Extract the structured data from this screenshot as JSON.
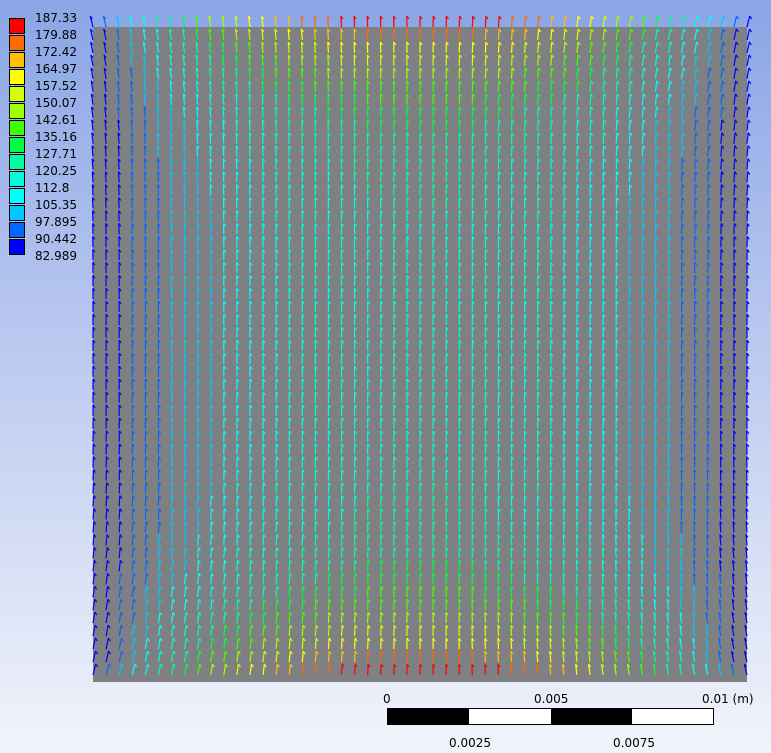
{
  "legend": {
    "values": [
      "187.33",
      "179.88",
      "172.42",
      "164.97",
      "157.52",
      "150.07",
      "142.61",
      "135.16",
      "127.71",
      "120.25",
      "112.8",
      "105.35",
      "97.895",
      "90.442",
      "82.989"
    ],
    "colors": [
      "#ff0000",
      "#ff6a00",
      "#ffc000",
      "#ffff00",
      "#d4ff00",
      "#a0ff00",
      "#40ff00",
      "#00ff40",
      "#00ffa0",
      "#00ffd8",
      "#00ffff",
      "#00c8ff",
      "#0068ff",
      "#0000ff"
    ],
    "min": 82.989,
    "max": 187.33
  },
  "scale_bar": {
    "top_labels": [
      "0",
      "0.005",
      "0.01 (m)"
    ],
    "bottom_labels": [
      "0.0025",
      "0.0075"
    ]
  }
}
